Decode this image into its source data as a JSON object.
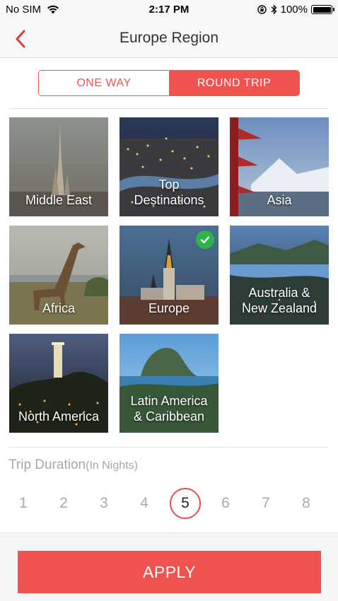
{
  "status_bar": {
    "carrier": "No SIM",
    "time": "2:17 PM",
    "battery_text": "100%",
    "battery_level": 1.0
  },
  "nav": {
    "title": "Europe Region",
    "back_icon": "chevron-left-icon"
  },
  "trip_type": {
    "options": [
      "ONE WAY",
      "ROUND TRIP"
    ],
    "selected": "ROUND TRIP"
  },
  "regions": [
    {
      "lines": [
        "Middle East"
      ],
      "selected": false
    },
    {
      "lines": [
        "Top",
        "Destinations"
      ],
      "selected": false
    },
    {
      "lines": [
        "Asia"
      ],
      "selected": false
    },
    {
      "lines": [
        "Africa"
      ],
      "selected": false
    },
    {
      "lines": [
        "Europe"
      ],
      "selected": true
    },
    {
      "lines": [
        "Australia &",
        "New Zealand"
      ],
      "selected": false
    },
    {
      "lines": [
        "North America"
      ],
      "selected": false
    },
    {
      "lines": [
        "Latin America",
        "& Caribbean"
      ],
      "selected": false
    }
  ],
  "duration": {
    "title": "Trip Duration",
    "subtitle": "(In Nights)",
    "options": [
      "1",
      "2",
      "3",
      "4",
      "5",
      "6",
      "7",
      "8"
    ],
    "selected": "5"
  },
  "apply_label": "APPLY",
  "colors": {
    "accent": "#ef5350",
    "check": "#2eb34a"
  }
}
